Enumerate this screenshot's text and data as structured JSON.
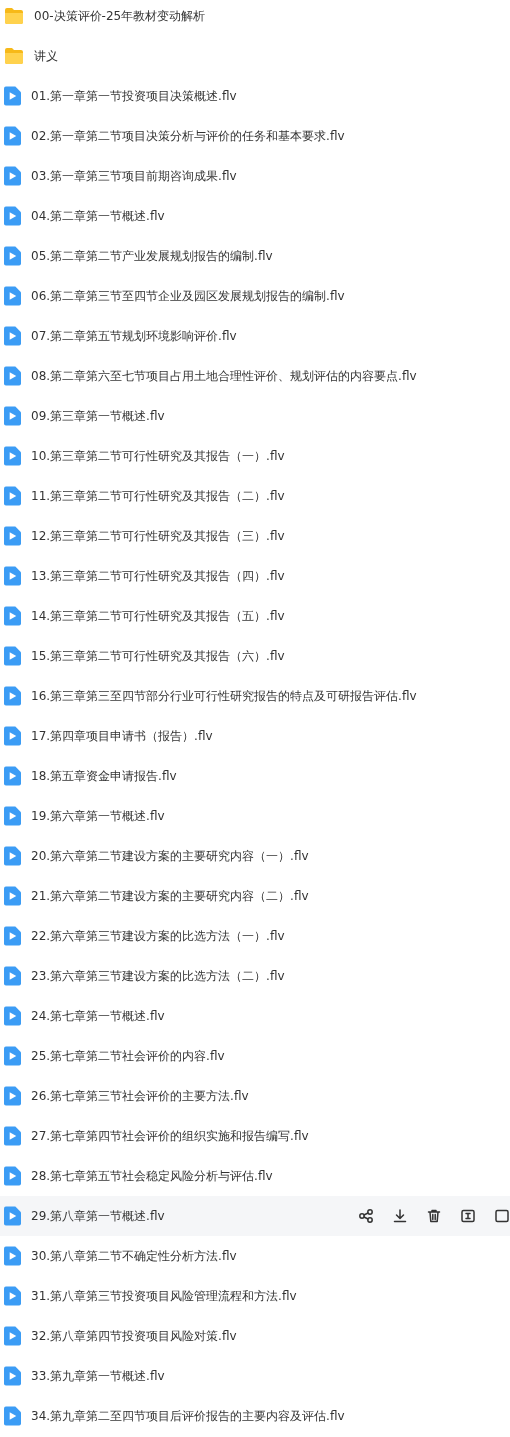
{
  "files": [
    {
      "kind": "folder",
      "name": "00-决策评价-25年教材变动解析",
      "hovered": false
    },
    {
      "kind": "folder",
      "name": "讲义",
      "hovered": false
    },
    {
      "kind": "video",
      "name": "01.第一章第一节投资项目决策概述.flv",
      "hovered": false
    },
    {
      "kind": "video",
      "name": "02.第一章第二节项目决策分析与评价的任务和基本要求.flv",
      "hovered": false
    },
    {
      "kind": "video",
      "name": "03.第一章第三节项目前期咨询成果.flv",
      "hovered": false
    },
    {
      "kind": "video",
      "name": "04.第二章第一节概述.flv",
      "hovered": false
    },
    {
      "kind": "video",
      "name": "05.第二章第二节产业发展规划报告的编制.flv",
      "hovered": false
    },
    {
      "kind": "video",
      "name": "06.第二章第三节至四节企业及园区发展规划报告的编制.flv",
      "hovered": false
    },
    {
      "kind": "video",
      "name": "07.第二章第五节规划环境影响评价.flv",
      "hovered": false
    },
    {
      "kind": "video",
      "name": "08.第二章第六至七节项目占用土地合理性评价、规划评估的内容要点.flv",
      "hovered": false
    },
    {
      "kind": "video",
      "name": "09.第三章第一节概述.flv",
      "hovered": false
    },
    {
      "kind": "video",
      "name": "10.第三章第二节可行性研究及其报告（一）.flv",
      "hovered": false
    },
    {
      "kind": "video",
      "name": "11.第三章第二节可行性研究及其报告（二）.flv",
      "hovered": false
    },
    {
      "kind": "video",
      "name": "12.第三章第二节可行性研究及其报告（三）.flv",
      "hovered": false
    },
    {
      "kind": "video",
      "name": "13.第三章第二节可行性研究及其报告（四）.flv",
      "hovered": false
    },
    {
      "kind": "video",
      "name": "14.第三章第二节可行性研究及其报告（五）.flv",
      "hovered": false
    },
    {
      "kind": "video",
      "name": "15.第三章第二节可行性研究及其报告（六）.flv",
      "hovered": false
    },
    {
      "kind": "video",
      "name": "16.第三章第三至四节部分行业可行性研究报告的特点及可研报告评估.flv",
      "hovered": false
    },
    {
      "kind": "video",
      "name": "17.第四章项目申请书（报告）.flv",
      "hovered": false
    },
    {
      "kind": "video",
      "name": "18.第五章资金申请报告.flv",
      "hovered": false
    },
    {
      "kind": "video",
      "name": "19.第六章第一节概述.flv",
      "hovered": false
    },
    {
      "kind": "video",
      "name": "20.第六章第二节建设方案的主要研究内容（一）.flv",
      "hovered": false
    },
    {
      "kind": "video",
      "name": "21.第六章第二节建设方案的主要研究内容（二）.flv",
      "hovered": false
    },
    {
      "kind": "video",
      "name": "22.第六章第三节建设方案的比选方法（一）.flv",
      "hovered": false
    },
    {
      "kind": "video",
      "name": "23.第六章第三节建设方案的比选方法（二）.flv",
      "hovered": false
    },
    {
      "kind": "video",
      "name": "24.第七章第一节概述.flv",
      "hovered": false
    },
    {
      "kind": "video",
      "name": "25.第七章第二节社会评价的内容.flv",
      "hovered": false
    },
    {
      "kind": "video",
      "name": "26.第七章第三节社会评价的主要方法.flv",
      "hovered": false
    },
    {
      "kind": "video",
      "name": "27.第七章第四节社会评价的组织实施和报告编写.flv",
      "hovered": false
    },
    {
      "kind": "video",
      "name": "28.第七章第五节社会稳定风险分析与评估.flv",
      "hovered": false
    },
    {
      "kind": "video",
      "name": "29.第八章第一节概述.flv",
      "hovered": true
    },
    {
      "kind": "video",
      "name": "30.第八章第二节不确定性分析方法.flv",
      "hovered": false
    },
    {
      "kind": "video",
      "name": "31.第八章第三节投资项目风险管理流程和方法.flv",
      "hovered": false
    },
    {
      "kind": "video",
      "name": "32.第八章第四节投资项目风险对策.flv",
      "hovered": false
    },
    {
      "kind": "video",
      "name": "33.第九章第一节概述.flv",
      "hovered": false
    },
    {
      "kind": "video",
      "name": "34.第九章第二至四节项目后评价报告的主要内容及评估.flv",
      "hovered": false
    }
  ]
}
